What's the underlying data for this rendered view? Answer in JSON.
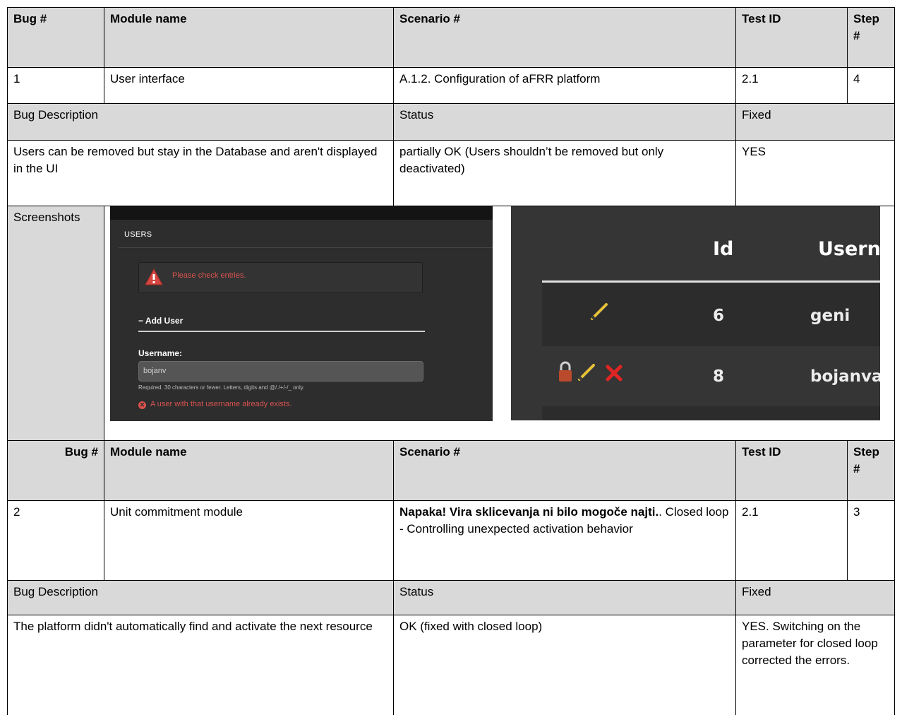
{
  "headers": {
    "bug": "Bug #",
    "module": "Module name",
    "scenario": "Scenario #",
    "test_id": "Test ID",
    "step": "Step #"
  },
  "sub_headers": {
    "description": "Bug Description",
    "status": "Status",
    "fixed": "Fixed"
  },
  "bugs": [
    {
      "bug": "1",
      "module": "User interface",
      "scenario_bold": "",
      "scenario": "A.1.2. Configuration of aFRR platform",
      "test_id": "2.1",
      "step": "4",
      "description": "Users can be removed but stay in the Database and aren't displayed in the UI",
      "status": "partially OK (Users shouldn’t be removed but only deactivated)",
      "fixed": "YES"
    },
    {
      "bug": "2",
      "module": "Unit commitment module",
      "scenario_bold": "Napaka! Vira sklicevanja ni bilo mogoče najti.",
      "scenario": ". Closed loop - Controlling unexpected activation behavior",
      "test_id": "2.1",
      "step": "3",
      "description": "The platform didn't automatically find and activate the next resource",
      "status": "OK (fixed with closed loop)",
      "fixed": "YES. Switching on the parameter for closed loop corrected the errors."
    }
  ],
  "screenshots_label": "Screenshots",
  "shot1": {
    "title": "USERS",
    "alert": "Please check entries.",
    "section": "− Add User",
    "field_label": "Username:",
    "field_value": "bojanv",
    "help": "Required. 30 characters or fewer. Letters, digits and @/./+/-/_ only.",
    "error": "A user with that username already exists."
  },
  "shot2": {
    "col_id": "Id",
    "col_user": "Usern",
    "rows": [
      {
        "id": "6",
        "user": "geni"
      },
      {
        "id": "8",
        "user": "bojanva"
      }
    ]
  }
}
